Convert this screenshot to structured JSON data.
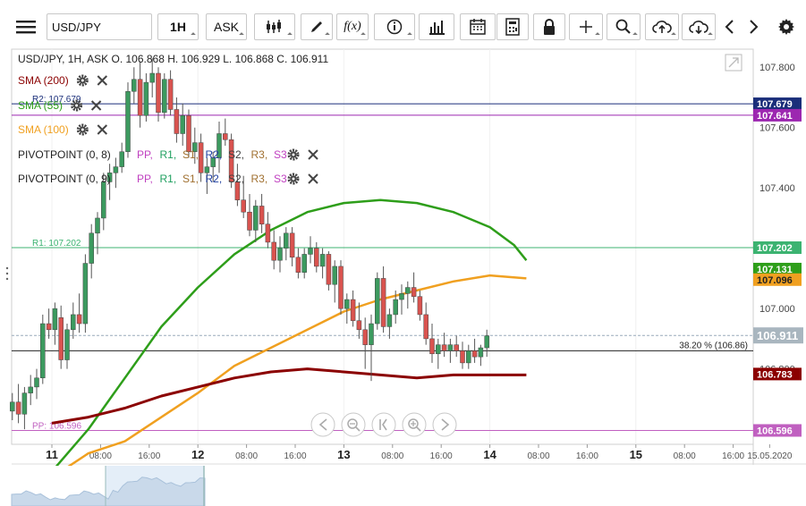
{
  "toolbar": {
    "symbol_value": "USD/JPY",
    "interval_label": "1H",
    "price_type_label": "ASK",
    "function_label": "f(x)",
    "icons": [
      "menu-icon",
      "candlestick-type-icon",
      "pen-draw-icon",
      "function-icon",
      "info-icon",
      "bar-chart-icon",
      "calendar-icon",
      "calculator-icon",
      "lock-icon",
      "crosshair-icon",
      "zoom-icon",
      "cloud-upload-icon",
      "cloud-download-icon",
      "chevron-left-icon",
      "chevron-right-icon",
      "gear-icon"
    ]
  },
  "legend": {
    "header": "USD/JPY, 1H, ASK",
    "ohlc": "O. 106.868 H. 106.929 L. 106.868 C. 106.911",
    "indicators": [
      {
        "label": "SMA (200)",
        "color": "#8b0000"
      },
      {
        "label": "SMA (55)",
        "color": "#2e9e1a"
      },
      {
        "label": "SMA (100)",
        "color": "#f0a020"
      },
      {
        "label": "PIVOTPOINT (0, 8)",
        "color": "#222222"
      },
      {
        "label": "PIVOTPOINT (0, 9)",
        "color": "#222222"
      }
    ],
    "pivot_levels": [
      {
        "text": "PP",
        "color": "#c040c0"
      },
      {
        "text": "R1",
        "color": "#20a060"
      },
      {
        "text": "S1",
        "color": "#a07030"
      },
      {
        "text": "R2",
        "color": "#2040a0"
      },
      {
        "text": "S2",
        "color": "#404040"
      },
      {
        "text": "R3",
        "color": "#a07030"
      },
      {
        "text": "S3",
        "color": "#c040c0"
      }
    ]
  },
  "chart_data": {
    "type": "candlestick",
    "symbol": "USD/JPY",
    "interval": "1H",
    "ylim": [
      106.55,
      107.86
    ],
    "y_ticks": [
      107.8,
      107.6,
      107.4,
      107.2,
      107.0,
      106.8
    ],
    "y_tick_labels": [
      "107.800",
      "107.600",
      "107.400",
      "107.200",
      "107.000",
      "106.800"
    ],
    "x_labels": [
      {
        "hour": 0,
        "label": "11",
        "bold": true
      },
      {
        "hour": 8,
        "label": "08:00"
      },
      {
        "hour": 16,
        "label": "16:00"
      },
      {
        "hour": 24,
        "label": "12",
        "bold": true
      },
      {
        "hour": 32,
        "label": "08:00"
      },
      {
        "hour": 40,
        "label": "16:00"
      },
      {
        "hour": 48,
        "label": "13",
        "bold": true
      },
      {
        "hour": 56,
        "label": "08:00"
      },
      {
        "hour": 64,
        "label": "16:00"
      },
      {
        "hour": 72,
        "label": "14",
        "bold": true
      },
      {
        "hour": 80,
        "label": "08:00"
      },
      {
        "hour": 88,
        "label": "16:00"
      },
      {
        "hour": 96,
        "label": "15",
        "bold": true
      },
      {
        "hour": 104,
        "label": "08:00"
      },
      {
        "hour": 112,
        "label": "16:00"
      },
      {
        "hour": 118,
        "label": "15.05.2020"
      }
    ],
    "levels": [
      {
        "name": "R2",
        "label": "R2: 107.679",
        "value": 107.679,
        "color": "#1a2e7a",
        "tag_bg": "#1a2e7a"
      },
      {
        "name": "",
        "label": "",
        "value": 107.641,
        "color": "#9c27b0",
        "tag_bg": "#9c27b0"
      },
      {
        "name": "R1",
        "label": "R1: 107.202",
        "value": 107.202,
        "color": "#3cb371",
        "tag_bg": "#3cb371"
      },
      {
        "name": "PP",
        "label": "PP: 106.596",
        "value": 106.596,
        "color": "#c060c0",
        "tag_bg": "#c060c0"
      }
    ],
    "fib_level": {
      "label": "38.20 % (106.86)",
      "value": 106.86
    },
    "last_price": {
      "value": 106.911,
      "label": "106.911"
    },
    "price_tags": [
      {
        "value": 107.131,
        "label": "107.131",
        "bg": "#2e9e1a",
        "fg": "#ffffff"
      },
      {
        "value": 107.096,
        "label": "107.096",
        "bg": "#f0a020",
        "fg": "#222222"
      },
      {
        "value": 106.783,
        "label": "106.783",
        "bg": "#8b0000",
        "fg": "#ffffff"
      }
    ],
    "colors": {
      "up": "#3c9a5f",
      "down": "#d9534f",
      "sma200": "#8b0000",
      "sma55": "#2e9e1a",
      "sma100": "#f0a020"
    },
    "candles": [
      [
        106.66,
        106.72,
        106.63,
        106.69
      ],
      [
        106.69,
        106.75,
        106.62,
        106.65
      ],
      [
        106.65,
        106.74,
        106.6,
        106.72
      ],
      [
        106.72,
        106.78,
        106.68,
        106.74
      ],
      [
        106.74,
        106.8,
        106.7,
        106.77
      ],
      [
        106.77,
        106.98,
        106.75,
        106.95
      ],
      [
        106.95,
        107.0,
        106.9,
        106.93
      ],
      [
        106.93,
        107.02,
        106.88,
        107.0
      ],
      [
        106.97,
        107.01,
        106.8,
        106.83
      ],
      [
        106.83,
        106.95,
        106.8,
        106.93
      ],
      [
        106.93,
        107.02,
        106.9,
        106.98
      ],
      [
        106.98,
        107.05,
        106.92,
        106.95
      ],
      [
        106.95,
        107.18,
        106.92,
        107.15
      ],
      [
        107.15,
        107.28,
        107.1,
        107.25
      ],
      [
        107.25,
        107.32,
        107.18,
        107.3
      ],
      [
        107.3,
        107.45,
        107.26,
        107.42
      ],
      [
        107.42,
        107.48,
        107.36,
        107.45
      ],
      [
        107.45,
        107.5,
        107.4,
        107.47
      ],
      [
        107.47,
        107.55,
        107.45,
        107.52
      ],
      [
        107.52,
        107.75,
        107.5,
        107.72
      ],
      [
        107.72,
        107.8,
        107.68,
        107.76
      ],
      [
        107.76,
        107.82,
        107.6,
        107.64
      ],
      [
        107.64,
        107.78,
        107.62,
        107.75
      ],
      [
        107.75,
        107.83,
        107.7,
        107.78
      ],
      [
        107.78,
        107.8,
        107.62,
        107.65
      ],
      [
        107.65,
        107.78,
        107.63,
        107.76
      ],
      [
        107.76,
        107.79,
        107.64,
        107.66
      ],
      [
        107.66,
        107.7,
        107.55,
        107.58
      ],
      [
        107.58,
        107.68,
        107.54,
        107.64
      ],
      [
        107.64,
        107.66,
        107.5,
        107.52
      ],
      [
        107.52,
        107.6,
        107.48,
        107.55
      ],
      [
        107.55,
        107.58,
        107.42,
        107.45
      ],
      [
        107.45,
        107.5,
        107.38,
        107.47
      ],
      [
        107.47,
        107.52,
        107.42,
        107.5
      ],
      [
        107.5,
        107.62,
        107.45,
        107.58
      ],
      [
        107.58,
        107.63,
        107.54,
        107.56
      ],
      [
        107.56,
        107.58,
        107.4,
        107.42
      ],
      [
        107.42,
        107.48,
        107.34,
        107.36
      ],
      [
        107.36,
        107.44,
        107.3,
        107.32
      ],
      [
        107.32,
        107.38,
        107.24,
        107.26
      ],
      [
        107.26,
        107.36,
        107.22,
        107.34
      ],
      [
        107.34,
        107.38,
        107.25,
        107.28
      ],
      [
        107.28,
        107.32,
        107.2,
        107.22
      ],
      [
        107.22,
        107.26,
        107.13,
        107.16
      ],
      [
        107.16,
        107.24,
        107.12,
        107.2
      ],
      [
        107.2,
        107.27,
        107.16,
        107.25
      ],
      [
        107.25,
        107.27,
        107.14,
        107.17
      ],
      [
        107.17,
        107.2,
        107.1,
        107.12
      ],
      [
        107.12,
        107.2,
        107.1,
        107.18
      ],
      [
        107.18,
        107.24,
        107.15,
        107.2
      ],
      [
        107.2,
        107.22,
        107.12,
        107.14
      ],
      [
        107.14,
        107.2,
        107.1,
        107.18
      ],
      [
        107.18,
        107.19,
        107.06,
        107.08
      ],
      [
        107.08,
        107.16,
        107.02,
        107.14
      ],
      [
        107.14,
        107.16,
        106.98,
        107.0
      ],
      [
        107.0,
        107.05,
        106.95,
        107.03
      ],
      [
        107.03,
        107.06,
        106.94,
        106.96
      ],
      [
        106.96,
        107.02,
        106.9,
        106.93
      ],
      [
        106.93,
        106.97,
        106.8,
        106.88
      ],
      [
        106.88,
        106.98,
        106.76,
        106.95
      ],
      [
        106.95,
        107.12,
        106.93,
        107.1
      ],
      [
        107.1,
        107.14,
        106.92,
        106.94
      ],
      [
        106.94,
        107.0,
        106.9,
        106.98
      ],
      [
        106.98,
        107.06,
        106.95,
        107.03
      ],
      [
        107.03,
        107.08,
        106.98,
        107.05
      ],
      [
        107.05,
        107.09,
        107.0,
        107.07
      ],
      [
        107.07,
        107.12,
        107.02,
        107.04
      ],
      [
        107.04,
        107.06,
        106.96,
        106.98
      ],
      [
        106.98,
        107.02,
        106.88,
        106.9
      ],
      [
        106.9,
        106.95,
        106.82,
        106.85
      ],
      [
        106.85,
        106.9,
        106.8,
        106.88
      ],
      [
        106.88,
        106.92,
        106.84,
        106.86
      ],
      [
        106.86,
        106.9,
        106.82,
        106.88
      ],
      [
        106.88,
        106.91,
        106.84,
        106.86
      ],
      [
        106.86,
        106.89,
        106.8,
        106.82
      ],
      [
        106.82,
        106.88,
        106.8,
        106.86
      ],
      [
        106.86,
        106.9,
        106.82,
        106.84
      ],
      [
        106.84,
        106.88,
        106.81,
        106.87
      ],
      [
        106.87,
        106.93,
        106.84,
        106.91
      ]
    ],
    "sma55_points": [
      [
        0,
        106.46
      ],
      [
        6,
        106.6
      ],
      [
        12,
        106.77
      ],
      [
        18,
        106.94
      ],
      [
        24,
        107.07
      ],
      [
        30,
        107.18
      ],
      [
        36,
        107.26
      ],
      [
        42,
        107.32
      ],
      [
        48,
        107.35
      ],
      [
        54,
        107.36
      ],
      [
        60,
        107.35
      ],
      [
        66,
        107.32
      ],
      [
        72,
        107.27
      ],
      [
        76,
        107.21
      ],
      [
        78,
        107.16
      ]
    ],
    "sma100_points": [
      [
        0,
        106.44
      ],
      [
        6,
        106.52
      ],
      [
        12,
        106.56
      ],
      [
        18,
        106.64
      ],
      [
        24,
        106.72
      ],
      [
        30,
        106.81
      ],
      [
        36,
        106.87
      ],
      [
        42,
        106.93
      ],
      [
        48,
        106.99
      ],
      [
        54,
        107.03
      ],
      [
        60,
        107.06
      ],
      [
        66,
        107.09
      ],
      [
        72,
        107.11
      ],
      [
        78,
        107.1
      ]
    ],
    "sma200_points": [
      [
        0,
        106.62
      ],
      [
        6,
        106.64
      ],
      [
        12,
        106.67
      ],
      [
        18,
        106.71
      ],
      [
        24,
        106.74
      ],
      [
        30,
        106.77
      ],
      [
        36,
        106.79
      ],
      [
        42,
        106.8
      ],
      [
        48,
        106.79
      ],
      [
        54,
        106.78
      ],
      [
        60,
        106.77
      ],
      [
        66,
        106.78
      ],
      [
        72,
        106.78
      ],
      [
        78,
        106.78
      ]
    ],
    "footer_nav": [
      "arrow-left-icon",
      "zoom-out-icon",
      "fit-icon",
      "zoom-in-icon",
      "arrow-right-icon"
    ]
  }
}
